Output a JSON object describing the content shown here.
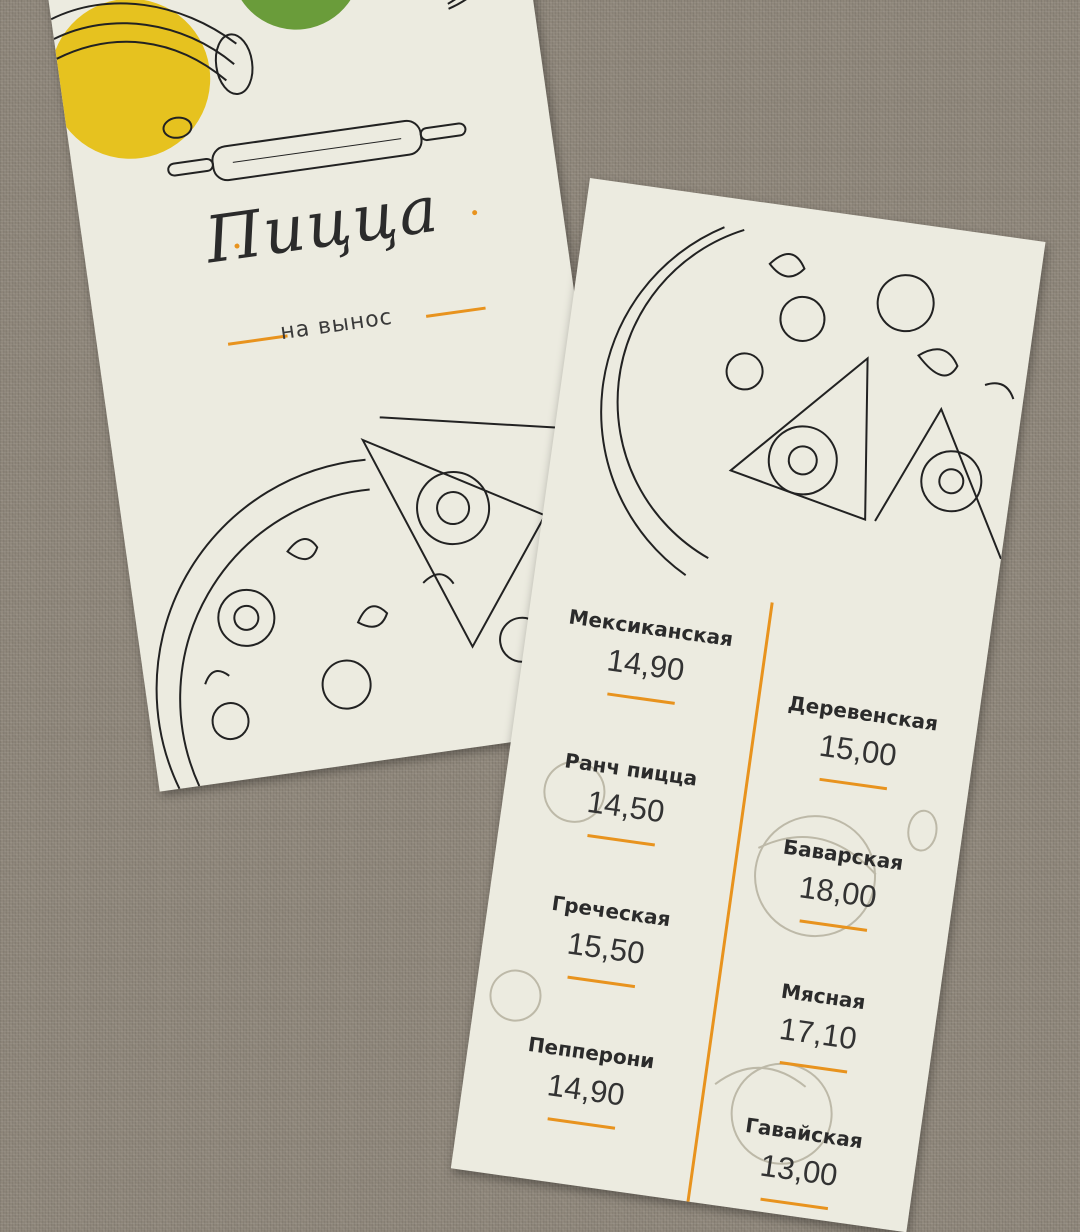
{
  "front_card": {
    "title": "Пицца",
    "subtitle": "на вынос"
  },
  "back_card": {
    "left_items": [
      {
        "name": "Мексиканская",
        "price": "14,90"
      },
      {
        "name": "Ранч пицца",
        "price": "14,50"
      },
      {
        "name": "Греческая",
        "price": "15,50"
      },
      {
        "name": "Пепперони",
        "price": "14,90"
      }
    ],
    "right_items": [
      {
        "name": "Деревенская",
        "price": "15,00"
      },
      {
        "name": "Баварская",
        "price": "18,00"
      },
      {
        "name": "Мясная",
        "price": "17,10"
      },
      {
        "name": "Гавайская",
        "price": "13,00"
      }
    ]
  },
  "colors": {
    "accent": "#e8931e",
    "paper": "#ecebe0",
    "background": "#8d8579",
    "ink": "#2b2b2b",
    "yellow": "#e6c21f",
    "green": "#6a9c3a",
    "red": "#d6443b"
  }
}
